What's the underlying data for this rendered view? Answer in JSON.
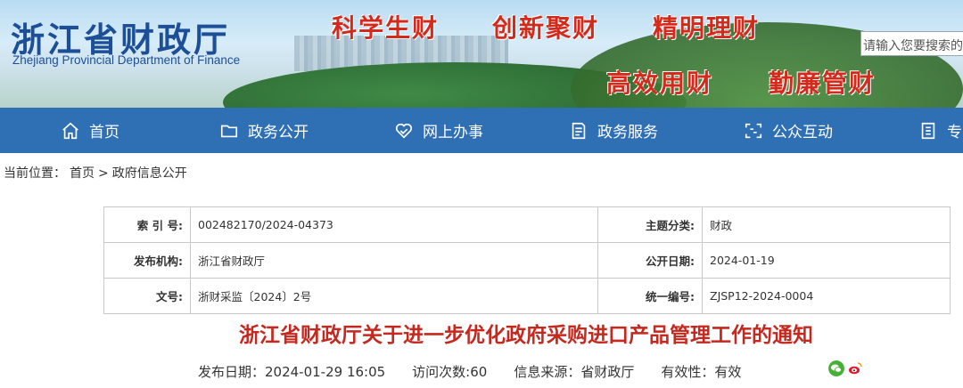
{
  "header": {
    "title": "浙江省财政厅",
    "subtitle": "Zhejiang Provincial Department of Finance",
    "slogans": [
      "科学生财",
      "创新聚财",
      "精明理财",
      "高效用财",
      "勤廉管财"
    ],
    "search_placeholder": "请输入您要搜索的"
  },
  "nav": {
    "items": [
      {
        "label": "首页",
        "icon": "home-icon"
      },
      {
        "label": "政务公开",
        "icon": "folder-icon"
      },
      {
        "label": "网上办事",
        "icon": "handshake-icon"
      },
      {
        "label": "政务服务",
        "icon": "document-icon"
      },
      {
        "label": "公众互动",
        "icon": "interaction-icon"
      },
      {
        "label": "专",
        "icon": "list-icon"
      }
    ]
  },
  "breadcrumb": {
    "prefix": "当前位置：",
    "items": [
      "首页",
      "政府信息公开"
    ],
    "separator": ">"
  },
  "meta": {
    "index_label": "索 引 号:",
    "index_value": "002482170/2024-04373",
    "topic_label": "主题分类:",
    "topic_value": "财政",
    "issuer_label": "发布机构:",
    "issuer_value": "浙江省财政厅",
    "public_date_label": "公开日期:",
    "public_date_value": "2024-01-19",
    "docno_label": "文号:",
    "docno_value": "浙财采监〔2024〕2号",
    "code_label": "统一编号:",
    "code_value": "ZJSP12-2024-0004"
  },
  "article": {
    "title": "浙江省财政厅关于进一步优化政府采购进口产品管理工作的通知",
    "publish_date": "发布日期：2024-01-29 16:05",
    "visits": "访问次数:60",
    "source": "信息来源：省财政厅",
    "validity": "有效性：有效"
  },
  "colors": {
    "nav_bg": "#2f6fb4",
    "title_red": "#c4281e",
    "logo_blue": "#1d4f98",
    "slogan_red": "#d42a1c"
  }
}
